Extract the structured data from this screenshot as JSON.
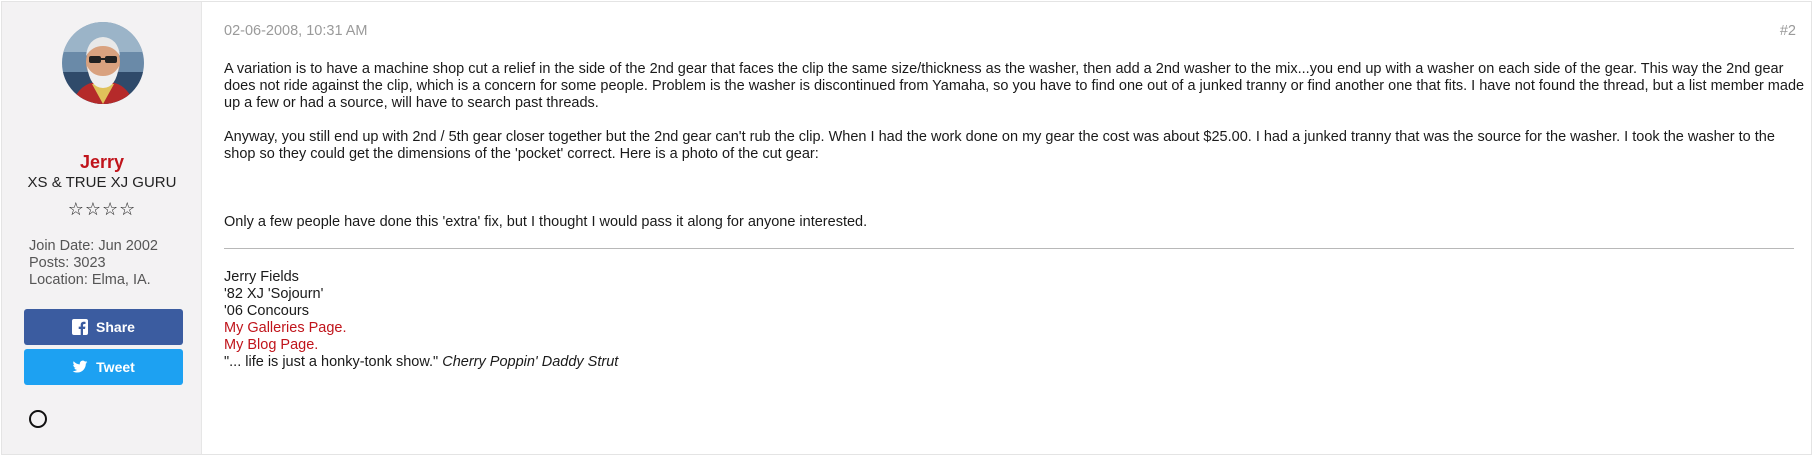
{
  "user": {
    "name": "Jerry",
    "title": "XS & TRUE XJ GURU",
    "stars": "☆☆☆☆",
    "join_date": "Join Date: Jun 2002",
    "posts": "Posts: 3023",
    "location": "Location: Elma, IA."
  },
  "buttons": {
    "share_label": "Share",
    "tweet_label": "Tweet"
  },
  "post": {
    "date": "02-06-2008, 10:31 AM",
    "number": "#2",
    "paragraphs": [
      "A variation is to have a machine shop cut a relief in the side of the 2nd gear that faces the clip the same size/thickness as the washer, then add a 2nd washer to the mix...you end up with a washer on each side of the gear. This way the 2nd gear does not ride against the clip, which is a concern for some people. Problem is the washer is discontinued from Yamaha, so you have to find one out of a junked tranny or find another one that fits. I have not found the thread, but a list member made up a few or had a source, will have to search past threads.",
      "Anyway, you still end up with 2nd / 5th gear closer together but the 2nd gear can't rub the clip. When I had the work done on my gear the cost was about $25.00. I had a junked tranny that was the source for the washer. I took the washer to the shop so they could get the dimensions of the 'pocket' correct. Here is a photo of the cut gear:",
      "Only a few people have done this 'extra' fix, but I thought I would pass it along for anyone interested."
    ]
  },
  "signature": {
    "line1": "Jerry Fields",
    "line2": "'82 XJ 'Sojourn'",
    "line3": "'06 Concours",
    "link1": "My Galleries Page.",
    "link2": "My Blog Page.",
    "quote": "\"... life is just a honky-tonk show.\"",
    "quote_source": "Cherry Poppin' Daddy Strut"
  },
  "colors": {
    "username": "#c0141b",
    "share_bg": "#3b5ca0",
    "tweet_bg": "#1da1f2",
    "link": "#c0141b"
  }
}
